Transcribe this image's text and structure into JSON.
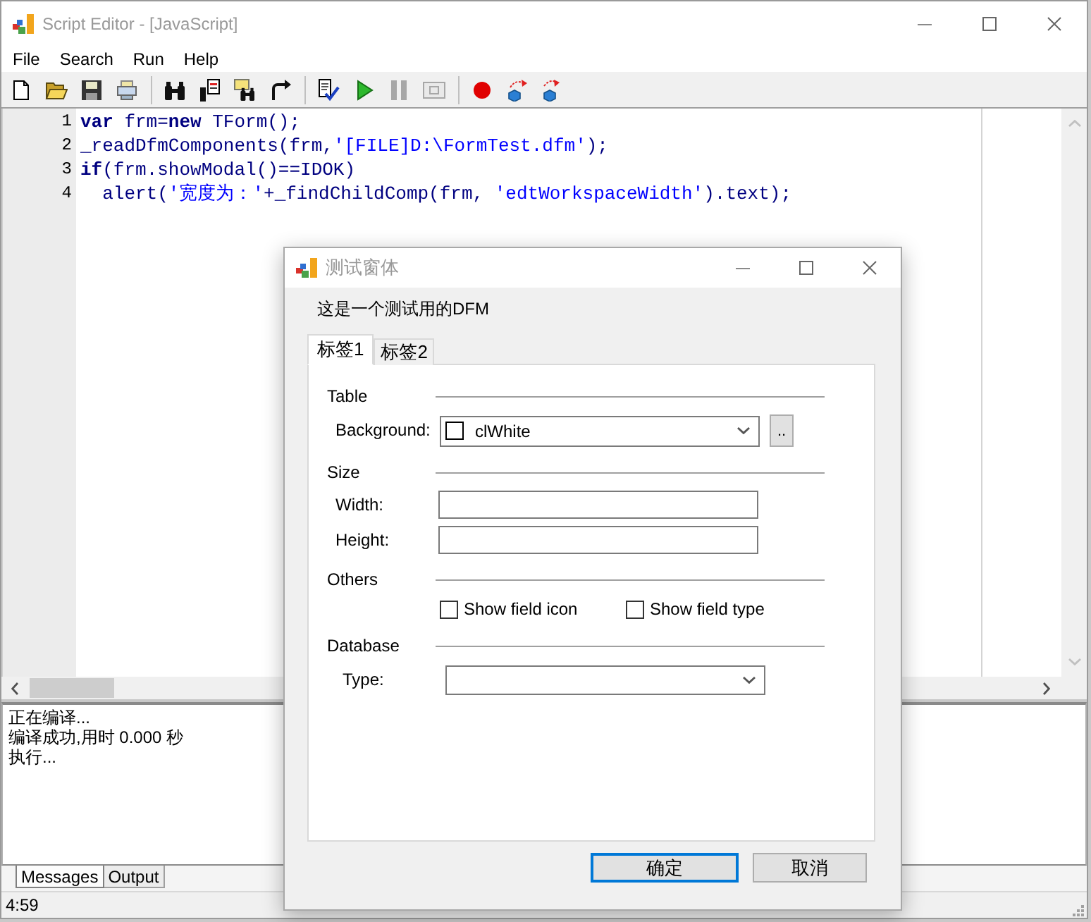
{
  "window": {
    "title": "Script Editor - [JavaScript]"
  },
  "menu": [
    "File",
    "Search",
    "Run",
    "Help"
  ],
  "toolbar": [
    [
      {
        "kind": "new",
        "disabled": false
      },
      {
        "kind": "open",
        "disabled": false
      },
      {
        "kind": "save",
        "disabled": false
      },
      {
        "kind": "preview",
        "disabled": false
      }
    ],
    [
      {
        "kind": "find",
        "disabled": false
      },
      {
        "kind": "replace",
        "disabled": false
      },
      {
        "kind": "findnext",
        "disabled": false
      },
      {
        "kind": "goto",
        "disabled": false
      }
    ],
    [
      {
        "kind": "compile",
        "disabled": false
      },
      {
        "kind": "run",
        "disabled": false
      },
      {
        "kind": "pause",
        "disabled": true
      },
      {
        "kind": "stop",
        "disabled": true
      }
    ],
    [
      {
        "kind": "breakpoint",
        "disabled": false
      },
      {
        "kind": "stepinto",
        "disabled": false
      },
      {
        "kind": "stepover",
        "disabled": false
      }
    ]
  ],
  "editor": {
    "lines": [
      {
        "number": "1",
        "tokens": [
          {
            "kind": "keyword",
            "text": "var"
          },
          {
            "kind": "plain",
            "text": " frm="
          },
          {
            "kind": "keyword",
            "text": "new"
          },
          {
            "kind": "plain",
            "text": " TForm();"
          }
        ]
      },
      {
        "number": "2",
        "tokens": [
          {
            "kind": "plain",
            "text": "_readDfmComponents(frm,"
          },
          {
            "kind": "string",
            "text": "'[FILE]D:\\FormTest.dfm'"
          },
          {
            "kind": "plain",
            "text": ");"
          }
        ]
      },
      {
        "number": "3",
        "tokens": [
          {
            "kind": "keyword",
            "text": "if"
          },
          {
            "kind": "plain",
            "text": "(frm.showModal()==IDOK)"
          }
        ]
      },
      {
        "number": "4",
        "tokens": [
          {
            "kind": "plain",
            "text": "  alert("
          },
          {
            "kind": "string",
            "text": "'宽度为：'"
          },
          {
            "kind": "plain",
            "text": "+_findChildComp(frm, "
          },
          {
            "kind": "string",
            "text": "'edtWorkspaceWidth'"
          },
          {
            "kind": "plain",
            "text": ").text);"
          }
        ]
      }
    ]
  },
  "messages": [
    "正在编译...",
    "编译成功,用时 0.000 秒",
    "执行..."
  ],
  "message_tabs": [
    {
      "label": "Messages",
      "selected": true
    },
    {
      "label": "Output",
      "selected": false
    }
  ],
  "status_bar": {
    "position": "4:59"
  },
  "dialog": {
    "title": "测试窗体",
    "caption": "这是一个测试用的DFM",
    "tabs": [
      {
        "label": "标签1",
        "selected": true
      },
      {
        "label": "标签2",
        "selected": false
      }
    ],
    "sections": [
      {
        "heading": "Table",
        "rows": [
          {
            "kind": "color_combo",
            "label": "Background:",
            "value": "clWhite",
            "button": ".."
          }
        ]
      },
      {
        "heading": "Size",
        "rows": [
          {
            "kind": "input",
            "label": "Width:"
          },
          {
            "kind": "input",
            "label": "Height:"
          }
        ]
      },
      {
        "heading": "Others",
        "rows": [
          {
            "kind": "checkboxes",
            "items": [
              {
                "label": "Show field icon",
                "checked": false
              },
              {
                "label": "Show field type",
                "checked": false
              }
            ]
          }
        ]
      },
      {
        "heading": "Database",
        "rows": [
          {
            "kind": "combo",
            "label": "Type:"
          }
        ]
      }
    ],
    "buttons": [
      {
        "label": "确定",
        "default": true
      },
      {
        "label": "取消",
        "default": false
      }
    ]
  }
}
